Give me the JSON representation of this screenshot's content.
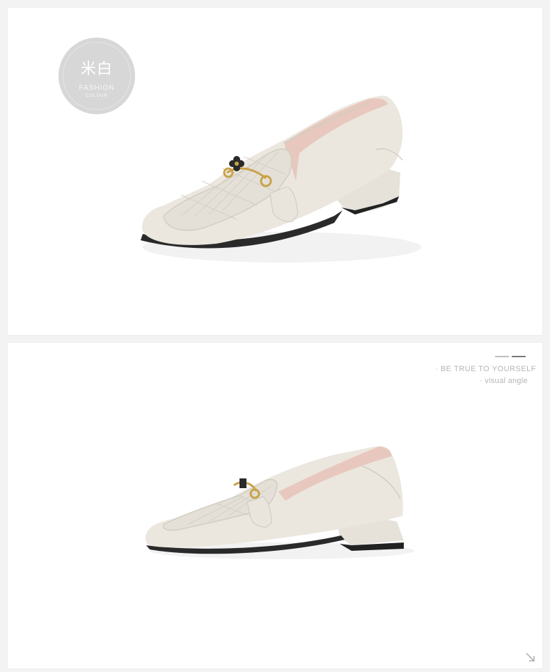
{
  "badge": {
    "title": "米白",
    "subtitle_line1": "FASHION",
    "subtitle_line2": "COLOUR"
  },
  "slogan": {
    "line1": "· BE TRUE TO YOURSELF",
    "line2": "· visual angle"
  },
  "colors": {
    "page_background": "#f3f3f3",
    "panel_background": "#ffffff",
    "shoe_leather": "#ebe7df",
    "badge_background": "#d7d7d7",
    "slogan_text": "#b5b5b5"
  },
  "icons": {
    "corner_arrow": "arrow-down-right-icon"
  }
}
